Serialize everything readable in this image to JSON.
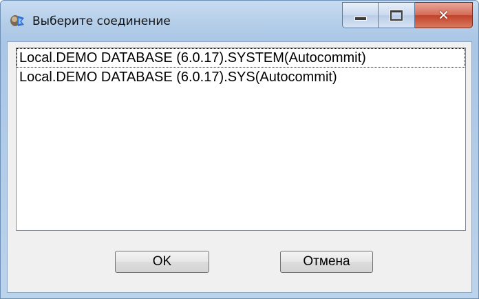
{
  "window": {
    "title": "Выберите соединение",
    "icon": "database-connect-icon"
  },
  "caption_buttons": {
    "minimize": "minimize-icon",
    "maximize": "maximize-icon",
    "close": "close-icon"
  },
  "connections": {
    "items": [
      "Local.DEMO DATABASE (6.0.17).SYSTEM(Autocommit)",
      "Local.DEMO DATABASE (6.0.17).SYS(Autocommit)"
    ],
    "focused_index": 0
  },
  "buttons": {
    "ok": "OK",
    "cancel": "Отмена"
  },
  "colors": {
    "titlebar": "#b6cfe9",
    "close_button": "#c0422a",
    "client_background": "#f0f0f0"
  }
}
